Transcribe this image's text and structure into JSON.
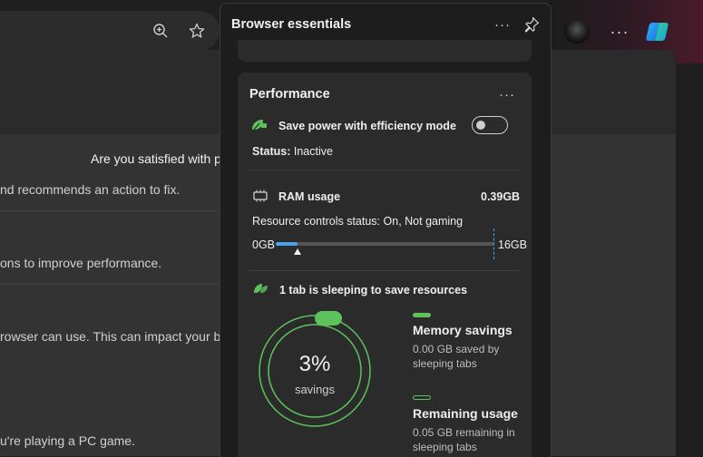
{
  "background": {
    "question": "Are you satisfied with pe",
    "lines": [
      "nd recommends an action to fix.",
      "ons to improve performance.",
      "rowser can use. This can impact your brow",
      "u're playing a PC game."
    ]
  },
  "toolbar": {
    "zoom_icon": "zoom-in-icon",
    "favorite_icon": "star-icon",
    "more_label": "···"
  },
  "panel": {
    "title": "Browser essentials",
    "more_label": "···",
    "pin_icon": "pin-icon"
  },
  "performance": {
    "title": "Performance",
    "more_label": "···",
    "efficiency": {
      "label": "Save power with efficiency mode",
      "toggle_on": false,
      "status_label": "Status:",
      "status_value": "Inactive"
    },
    "ram": {
      "label": "RAM usage",
      "value": "0.39GB",
      "controls_label": "Resource controls status:",
      "controls_value": "On, Not gaming",
      "min_label": "0GB",
      "max_label": "16GB",
      "usage_fraction": 0.0244
    },
    "sleeping": {
      "label": "1 tab is sleeping to save resources",
      "percent_label": "3%",
      "savings_label": "savings",
      "savings_fraction": 0.03,
      "memory_title": "Memory savings",
      "memory_desc_1": "0.00 GB saved by",
      "memory_desc_2": "sleeping tabs",
      "remaining_title": "Remaining usage",
      "remaining_desc_1": "0.05 GB remaining in",
      "remaining_desc_2": "sleeping tabs"
    }
  },
  "colors": {
    "accent_green": "#5cc35c",
    "accent_blue": "#4aa3f0"
  }
}
